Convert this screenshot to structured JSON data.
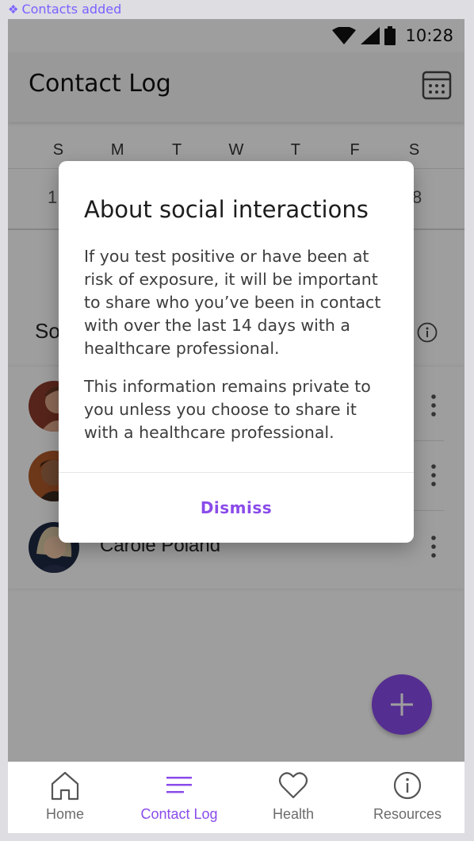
{
  "frame_label": "Contacts added",
  "status_bar": {
    "time": "10:28"
  },
  "app_bar": {
    "title": "Contact Log"
  },
  "week": {
    "days": [
      "S",
      "M",
      "T",
      "W",
      "T",
      "F",
      "S"
    ],
    "first_date_partial": "1",
    "last_date_partial": "8"
  },
  "section": {
    "title_partial": "So"
  },
  "contacts": [
    {
      "name": ""
    },
    {
      "name": ""
    },
    {
      "name": "Carole Poland"
    }
  ],
  "dialog": {
    "title": "About social interactions",
    "paragraph1": "If you test positive or have been at risk of exposure, it will be important to share who you’ve been in contact with over the last 14 days with a healthcare professional.",
    "paragraph2": "This information remains private to you unless you choose to share it with a healthcare professional.",
    "dismiss_label": "Dismiss"
  },
  "bottom_nav": {
    "items": [
      {
        "label": "Home",
        "icon": "home-icon",
        "active": false
      },
      {
        "label": "Contact Log",
        "icon": "list-icon",
        "active": true
      },
      {
        "label": "Health",
        "icon": "heart-icon",
        "active": false
      },
      {
        "label": "Resources",
        "icon": "info-icon",
        "active": false
      }
    ]
  },
  "colors": {
    "accent": "#8a4bea",
    "frame_label": "#7b61ff"
  }
}
